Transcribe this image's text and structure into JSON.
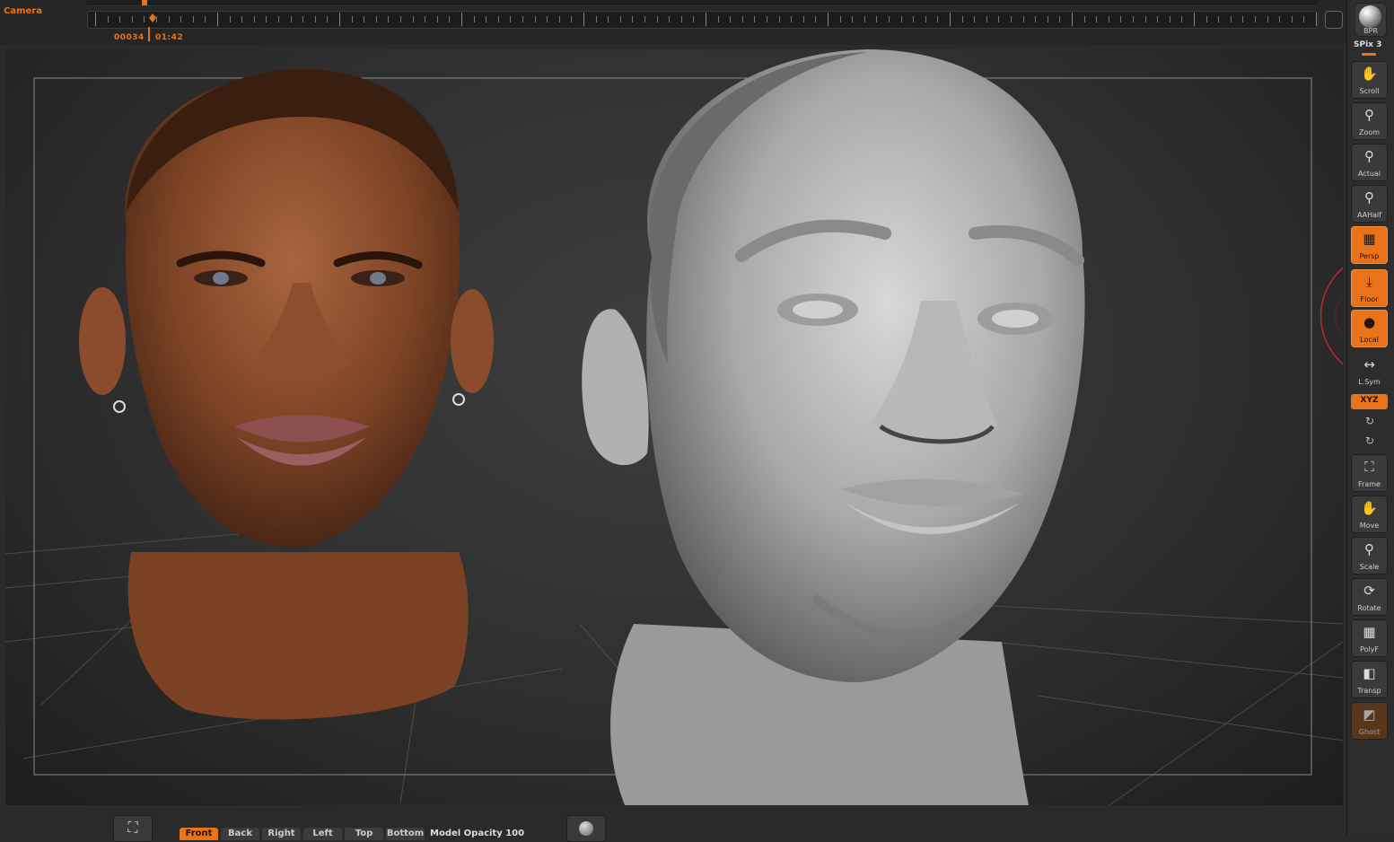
{
  "timeline": {
    "camera_label": "Camera",
    "frame_number": "00034",
    "time": "01:42"
  },
  "viewport": {
    "left_head": "textured-head-icon",
    "right_head": "sculpt-head-icon"
  },
  "shelf": {
    "bpr_label": "BPR",
    "spix_label": "SPix 3",
    "buttons": [
      {
        "label": "Scroll",
        "icon": "hand-icon",
        "active": false
      },
      {
        "label": "Zoom",
        "icon": "zoom-icon",
        "active": false
      },
      {
        "label": "Actual",
        "icon": "actual-icon",
        "active": false
      },
      {
        "label": "AAHalf",
        "icon": "aahalf-icon",
        "active": false
      },
      {
        "label": "Persp",
        "icon": "perspective-icon",
        "active": true
      },
      {
        "label": "Floor",
        "icon": "floor-icon",
        "active": true
      },
      {
        "label": "Local",
        "icon": "local-icon",
        "active": true
      },
      {
        "label": "L.Sym",
        "icon": "local-symmetry-icon",
        "active": false
      },
      {
        "label": "Frame",
        "icon": "frame-icon",
        "active": false
      },
      {
        "label": "Move",
        "icon": "move-icon",
        "active": false
      },
      {
        "label": "Scale",
        "icon": "scale-icon",
        "active": false
      },
      {
        "label": "Rotate",
        "icon": "rotate-icon",
        "active": false
      },
      {
        "label": "PolyF",
        "icon": "polyframe-icon",
        "active": false
      },
      {
        "label": "Transp",
        "icon": "transparency-icon",
        "active": false
      },
      {
        "label": "Ghost",
        "icon": "ghost-icon",
        "active": false
      }
    ],
    "xyz_label": "XYZ"
  },
  "bottom": {
    "views": [
      {
        "label": "Front",
        "active": true
      },
      {
        "label": "Back",
        "active": false
      },
      {
        "label": "Right",
        "active": false
      },
      {
        "label": "Left",
        "active": false
      },
      {
        "label": "Top",
        "active": false
      },
      {
        "label": "Bottom",
        "active": false
      }
    ],
    "model_opacity": "Model Opacity 100"
  }
}
